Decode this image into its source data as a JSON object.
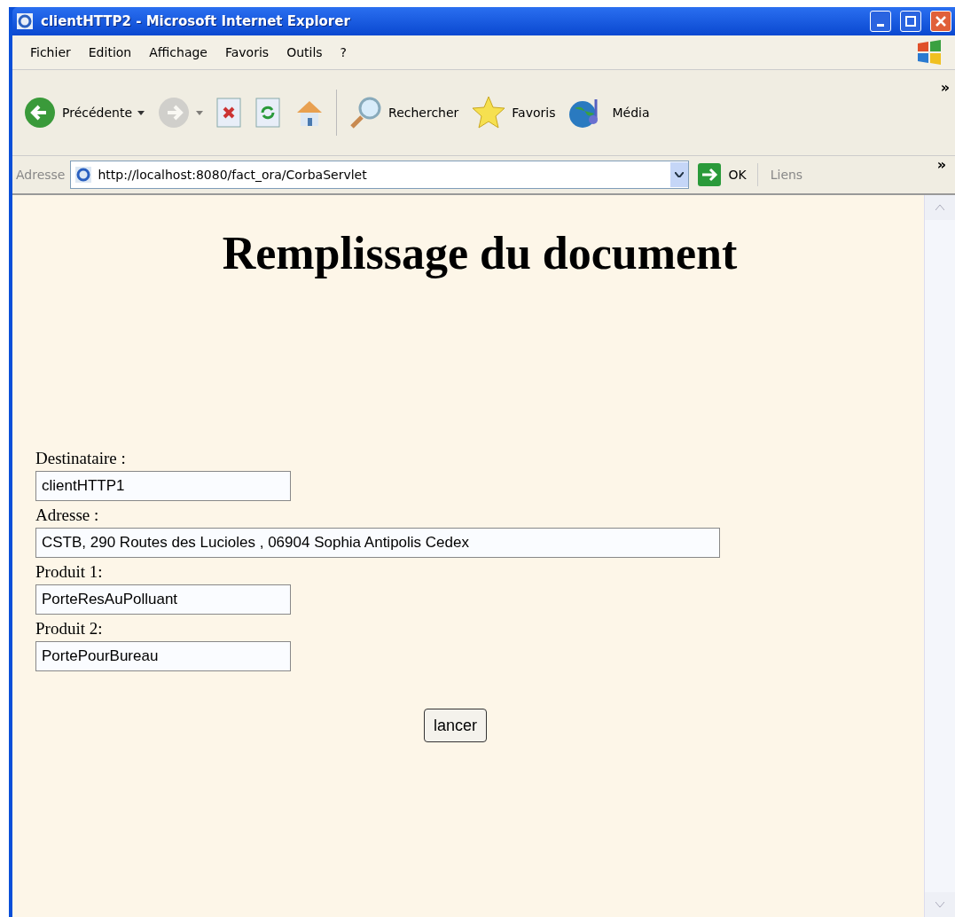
{
  "window": {
    "title": "clientHTTP2 - Microsoft Internet Explorer"
  },
  "menu": [
    "Fichier",
    "Edition",
    "Affichage",
    "Favoris",
    "Outils",
    "?"
  ],
  "toolbar": [
    {
      "kind": "back",
      "label": "Précédente",
      "dropdown": true,
      "disabled": false
    },
    {
      "kind": "forward",
      "dropdown": true,
      "disabled": true
    },
    {
      "kind": "stop",
      "disabled": false
    },
    {
      "kind": "refresh",
      "disabled": false
    },
    {
      "kind": "home",
      "disabled": false
    },
    {
      "kind": "search",
      "label": "Rechercher",
      "disabled": false
    },
    {
      "kind": "favorites",
      "label": "Favoris",
      "disabled": false
    },
    {
      "kind": "media",
      "label": "Média",
      "disabled": false
    }
  ],
  "toolbar_more": "»",
  "address_bar": {
    "label": "Adresse",
    "url": "http://localhost:8080/fact_ora/CorbaServlet",
    "go": "OK",
    "links": "Liens",
    "links_more": "»"
  },
  "page": {
    "heading": "Remplissage du document",
    "fields": [
      {
        "label": "Destinataire :",
        "value": "clientHTTP1",
        "wide": false
      },
      {
        "label": "Adresse :",
        "value": "CSTB, 290 Routes des Lucioles , 06904 Sophia Antipolis Cedex",
        "wide": true
      },
      {
        "label": "Produit 1:",
        "value": "PorteResAuPolluant",
        "wide": false
      },
      {
        "label": "Produit 2:",
        "value": "PortePourBureau",
        "wide": false
      }
    ],
    "submit": "lancer"
  }
}
